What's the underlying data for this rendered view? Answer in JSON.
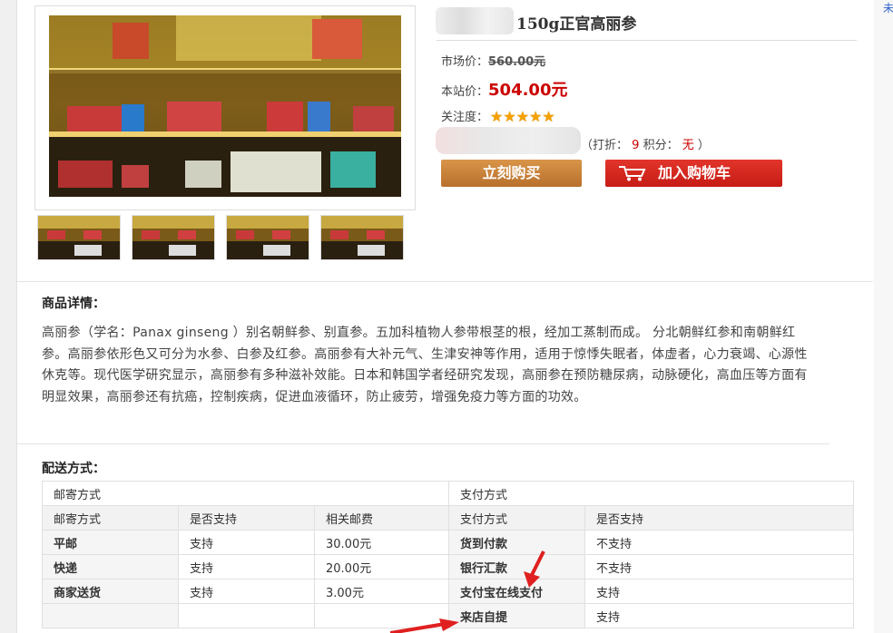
{
  "product": {
    "title": "150g正官高丽参",
    "market_price_label": "市场价：",
    "market_price": "560.00元",
    "our_price_label": "本站价：",
    "our_price": "504.00元",
    "attention_label": "关注度：",
    "rating_stars": 5,
    "discount_open": "（打折：",
    "discount_value": "9",
    "points_label": " 积分：",
    "points_value": "无",
    "discount_close": " ）",
    "buy_button": "立刻购买",
    "cart_button": "加入购物车"
  },
  "details": {
    "heading": "商品详情：",
    "text": "高丽参（学名：Panax ginseng ）别名朝鲜参、别直参。五加科植物人参带根茎的根，经加工蒸制而成。 分北朝鲜红参和南朝鲜红参。高丽参依形色又可分为水参、白参及红参。高丽参有大补元气、生津安神等作用，适用于惊悸失眠者，体虚者，心力衰竭、心源性休克等。现代医学研究显示，高丽参有多种滋补效能。日本和韩国学者经研究发现，高丽参在预防糖尿病，动脉硬化，高血压等方面有明显效果，高丽参还有抗癌，控制疾病，促进血液循环，防止疲劳，增强免疫力等方面的功效。"
  },
  "delivery": {
    "heading": "配送方式：",
    "mail_header": "邮寄方式",
    "pay_header": "支付方式",
    "mail_columns": [
      "邮寄方式",
      "是否支持",
      "相关邮费"
    ],
    "pay_columns": [
      "支付方式",
      "是否支持"
    ],
    "rows": [
      {
        "mail": "平邮",
        "mail_support": "支持",
        "fee": "30.00元",
        "pay": "货到付款",
        "pay_support": "不支持"
      },
      {
        "mail": "快递",
        "mail_support": "支持",
        "fee": "20.00元",
        "pay": "银行汇款",
        "pay_support": "不支持"
      },
      {
        "mail": "商家送货",
        "mail_support": "支持",
        "fee": "3.00元",
        "pay": "支付宝在线支付",
        "pay_support": "支持"
      },
      {
        "mail": "",
        "mail_support": "",
        "fee": "",
        "pay": "来店自提",
        "pay_support": "支持"
      }
    ]
  },
  "right_edge_char": "未",
  "colors": {
    "price_red": "#cc0000",
    "buy_button": "#c47f3a",
    "cart_button": "#d42a21",
    "star": "#f5a100",
    "arrow": "#e02020"
  }
}
